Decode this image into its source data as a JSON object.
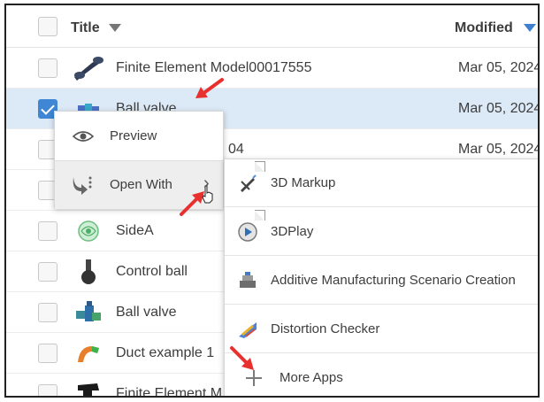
{
  "header": {
    "title_label": "Title",
    "modified_label": "Modified"
  },
  "rows": [
    {
      "name": "Finite Element Model00017555",
      "date": "Mar 05, 2024",
      "selected": false
    },
    {
      "name": "Ball valve",
      "date": "Mar 05, 2024",
      "selected": true
    },
    {
      "name": "04",
      "date": "Mar 05, 2024",
      "selected": false
    },
    {
      "name": "",
      "date": "",
      "selected": false
    },
    {
      "name": "SideA",
      "date": "",
      "selected": false
    },
    {
      "name": "Control ball",
      "date": "",
      "selected": false
    },
    {
      "name": "Ball valve",
      "date": "",
      "selected": false
    },
    {
      "name": "Duct example 1",
      "date": "",
      "selected": false
    },
    {
      "name": "Finite Element M",
      "date": "",
      "selected": false
    }
  ],
  "context_menu": {
    "preview_label": "Preview",
    "open_with_label": "Open With",
    "open_with_chevron": "›"
  },
  "submenu": {
    "items": [
      {
        "label": "3D Markup",
        "icon": "markup-3d-icon"
      },
      {
        "label": "3DPlay",
        "icon": "play-3d-icon"
      },
      {
        "label": "Additive Manufacturing Scenario Creation",
        "icon": "additive-manufacturing-icon"
      },
      {
        "label": "Distortion Checker",
        "icon": "distortion-checker-icon"
      },
      {
        "label": "More Apps",
        "icon": "plus-icon"
      }
    ]
  },
  "colors": {
    "accent": "#3f86d4",
    "selection": "#dce9f6",
    "annotation_arrow": "#e8312f"
  }
}
